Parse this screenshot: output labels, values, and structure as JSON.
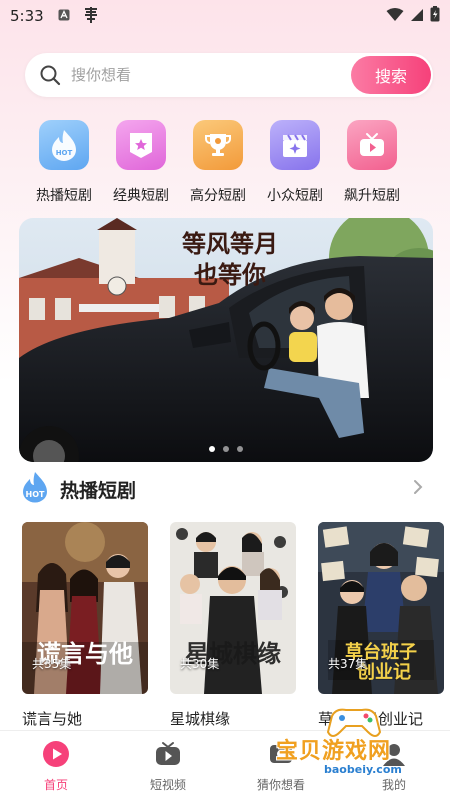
{
  "status_bar": {
    "time": "5:33",
    "icons": [
      "notification-a-icon",
      "app-notification-icon",
      "wifi-icon",
      "signal-icon",
      "battery-icon"
    ]
  },
  "search": {
    "placeholder": "搜你想看",
    "button_label": "搜索"
  },
  "categories": [
    {
      "label": "热播短剧",
      "icon": "hot-drop-icon",
      "color": "#6fb3f5"
    },
    {
      "label": "经典短剧",
      "icon": "star-badge-icon",
      "color": "#ea7ce3"
    },
    {
      "label": "高分短剧",
      "icon": "trophy-icon",
      "color": "#f7ae4e"
    },
    {
      "label": "小众短剧",
      "icon": "clapperboard-icon",
      "color": "#9c8cf2"
    },
    {
      "label": "飙升短剧",
      "icon": "tv-play-icon",
      "color": "#f67aa1"
    }
  ],
  "banner": {
    "title_line1": "等风等月",
    "title_line2": "也等你",
    "slide_count": 3,
    "active_slide": 1
  },
  "section": {
    "title": "热播短剧",
    "badge_text": "HOT"
  },
  "dramas": [
    {
      "title": "谎言与她",
      "episodes": "共35集"
    },
    {
      "title": "星城棋缘",
      "episodes": "共30集"
    },
    {
      "title": "草台班子创业记",
      "episodes": "共37集"
    }
  ],
  "tabs": [
    {
      "label": "首页",
      "icon": "home-play-icon",
      "active": true
    },
    {
      "label": "短视频",
      "icon": "short-video-icon",
      "active": false
    },
    {
      "label": "猜你想看",
      "icon": "guess-icon",
      "active": false
    },
    {
      "label": "我的",
      "icon": "profile-icon",
      "active": false
    }
  ],
  "watermark": {
    "text": "宝贝游戏网",
    "url": "baobeiy.com"
  },
  "colors": {
    "accent": "#f6417a",
    "search_gradient_start": "#fb7ba4"
  }
}
